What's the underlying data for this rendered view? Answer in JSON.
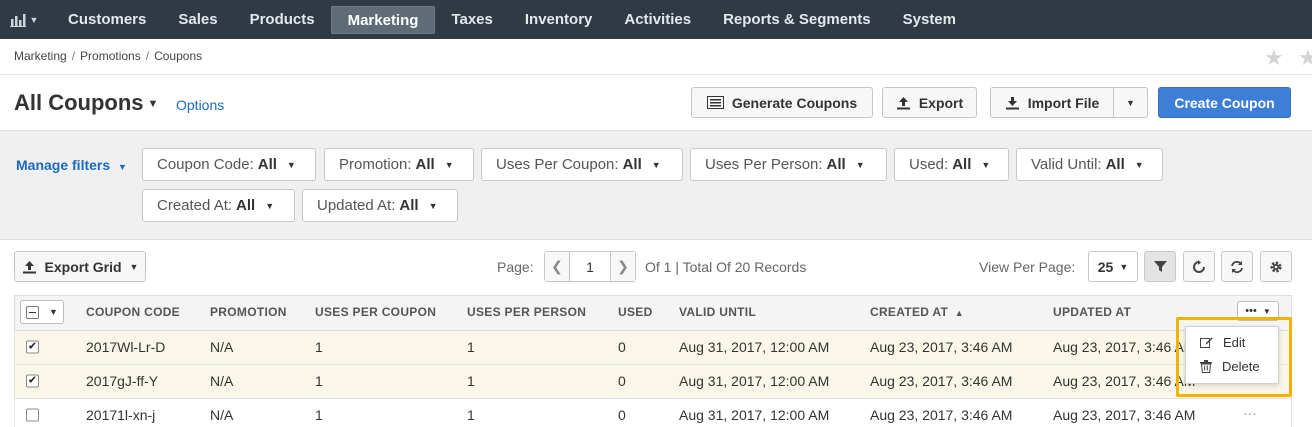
{
  "nav": {
    "items": [
      "Customers",
      "Sales",
      "Products",
      "Marketing",
      "Taxes",
      "Inventory",
      "Activities",
      "Reports & Segments",
      "System"
    ],
    "active": "Marketing"
  },
  "breadcrumb": [
    "Marketing",
    "Promotions",
    "Coupons"
  ],
  "page": {
    "title": "All Coupons",
    "options": "Options"
  },
  "buttons": {
    "generate": "Generate Coupons",
    "export": "Export",
    "import": "Import File",
    "create": "Create Coupon"
  },
  "filters": {
    "manage": "Manage filters",
    "items": [
      {
        "label": "Coupon Code:",
        "value": "All"
      },
      {
        "label": "Promotion:",
        "value": "All"
      },
      {
        "label": "Uses Per Coupon:",
        "value": "All"
      },
      {
        "label": "Uses Per Person:",
        "value": "All"
      },
      {
        "label": "Used:",
        "value": "All"
      },
      {
        "label": "Valid Until:",
        "value": "All"
      },
      {
        "label": "Created At:",
        "value": "All"
      },
      {
        "label": "Updated At:",
        "value": "All"
      }
    ]
  },
  "grid": {
    "export": "Export Grid",
    "page_label": "Page:",
    "page": "1",
    "total": "Of 1 | Total Of 20 Records",
    "per_page_label": "View Per Page:",
    "per_page": "25",
    "columns": [
      "COUPON CODE",
      "PROMOTION",
      "USES PER COUPON",
      "USES PER PERSON",
      "USED",
      "VALID UNTIL",
      "CREATED AT",
      "UPDATED AT"
    ],
    "rows": [
      {
        "checked": true,
        "code": "2017Wl-Lr-D",
        "promotion": "N/A",
        "per_coupon": "1",
        "per_person": "1",
        "used": "0",
        "valid": "Aug 31, 2017, 12:00 AM",
        "created": "Aug 23, 2017, 3:46 AM",
        "updated": "Aug 23, 2017, 3:46 AM"
      },
      {
        "checked": true,
        "code": "2017gJ-ff-Y",
        "promotion": "N/A",
        "per_coupon": "1",
        "per_person": "1",
        "used": "0",
        "valid": "Aug 31, 2017, 12:00 AM",
        "created": "Aug 23, 2017, 3:46 AM",
        "updated": "Aug 23, 2017, 3:46 AM"
      },
      {
        "checked": false,
        "code": "20171l-xn-j",
        "promotion": "N/A",
        "per_coupon": "1",
        "per_person": "1",
        "used": "0",
        "valid": "Aug 31, 2017, 12:00 AM",
        "created": "Aug 23, 2017, 3:46 AM",
        "updated": "Aug 23, 2017, 3:46 AM"
      }
    ]
  },
  "menu": {
    "edit": "Edit",
    "delete": "Delete"
  },
  "colors": {
    "nav_bg": "#2f3a44",
    "primary": "#3d7fd6",
    "link": "#1a6bbd",
    "highlight": "#f0b400",
    "selected_row": "#fbf7e8"
  }
}
